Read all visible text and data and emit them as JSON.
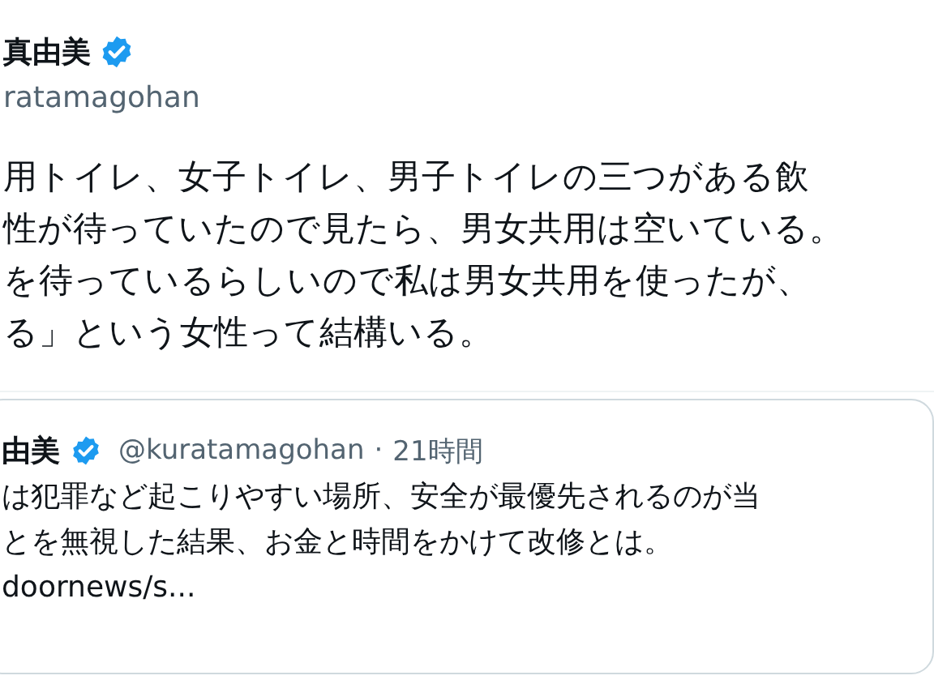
{
  "tweet": {
    "author_name": "真由美",
    "verified": true,
    "handle": "ratamagohan",
    "text_lines": [
      "用トイレ、女子トイレ、男子トイレの三つがある飲",
      "性が待っていたので見たら、男女共用は空いている。",
      "を待っているらしいので私は男女共用を使ったが、",
      "る」という女性って結構いる。"
    ]
  },
  "quoted_tweet": {
    "author_name": "由美",
    "verified": true,
    "handle": "@kuratamagohan",
    "separator": "·",
    "time": "21時間",
    "text_lines": [
      "は犯罪など起こりやすい場所、安全が最優先されるのが当",
      "とを無視した結果、お金と時間をかけて改修とは。"
    ],
    "link": "doornews/s..."
  }
}
